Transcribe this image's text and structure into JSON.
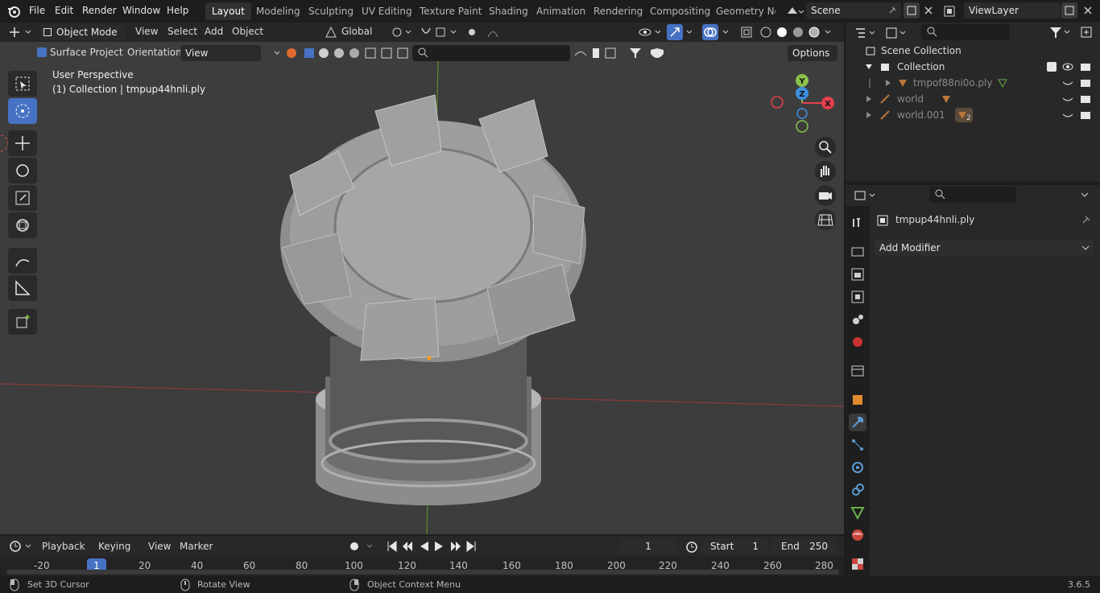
{
  "topbar": {
    "menus": [
      "File",
      "Edit",
      "Render",
      "Window",
      "Help"
    ],
    "workspaces": [
      "Layout",
      "Modeling",
      "Sculpting",
      "UV Editing",
      "Texture Paint",
      "Shading",
      "Animation",
      "Rendering",
      "Compositing",
      "Geometry Noc"
    ],
    "active_workspace": "Layout",
    "scene": "Scene",
    "view_layer": "ViewLayer"
  },
  "viewport_header": {
    "mode": "Object Mode",
    "menus": [
      "View",
      "Select",
      "Add",
      "Object"
    ],
    "transform_orientation": "Global",
    "surface_project_label": "Surface Project",
    "orientation_label": "Orientation:",
    "orientation_value": "View",
    "options_label": "Options"
  },
  "viewport": {
    "perspective_label": "User Perspective",
    "object_label": "(1) Collection | tmpup44hnli.ply",
    "gizmo_axes": [
      "Y",
      "Z",
      "X"
    ]
  },
  "outliner": {
    "root": "Scene Collection",
    "collection": "Collection",
    "items": [
      {
        "name": "tmpof88ni0o.ply"
      },
      {
        "name": "world"
      },
      {
        "name": "world.001",
        "badge": "2"
      }
    ]
  },
  "properties": {
    "object_name": "tmpup44hnli.ply",
    "add_modifier_label": "Add Modifier"
  },
  "timeline": {
    "menus": [
      "Playback",
      "Keying",
      "View",
      "Marker"
    ],
    "current_frame": "1",
    "start_label": "Start",
    "start_value": "1",
    "end_label": "End",
    "end_value": "250",
    "ruler": [
      "-20",
      "20",
      "40",
      "60",
      "80",
      "100",
      "120",
      "140",
      "160",
      "180",
      "200",
      "220",
      "240",
      "260",
      "280"
    ],
    "current_marker": "1"
  },
  "statusbar": {
    "hint1": "Set 3D Cursor",
    "hint2": "Rotate View",
    "hint3": "Object Context Menu",
    "version": "3.6.5"
  },
  "colors": {
    "accent": "#4672c3",
    "axis_x": "#e6404e",
    "axis_y": "#8bc34a",
    "axis_z": "#3d8fe0",
    "viewport_bg": "#3d3d3d"
  }
}
